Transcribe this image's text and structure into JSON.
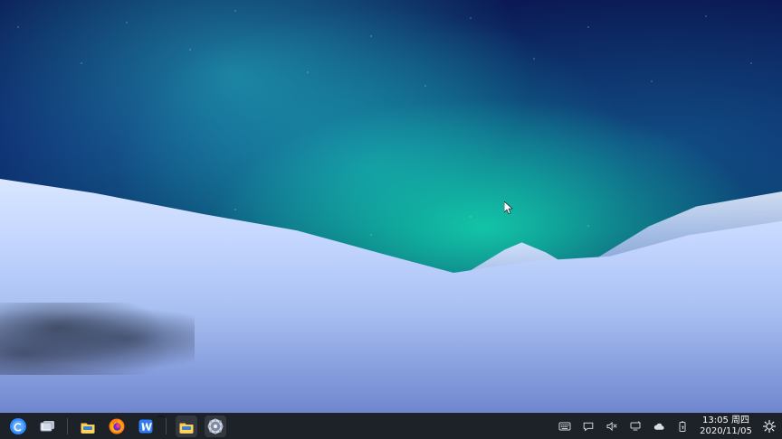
{
  "taskbar": {
    "apps": [
      {
        "name": "Start menu",
        "icon": "start-menu-icon"
      },
      {
        "name": "Show desktop",
        "icon": "desktop-switcher-icon"
      },
      {
        "name": "File manager",
        "icon": "folder-icon"
      },
      {
        "name": "Firefox",
        "icon": "firefox-icon"
      },
      {
        "name": "WPS Writer",
        "icon": "writer-icon"
      },
      {
        "name": "File manager (running)",
        "icon": "folder-icon"
      },
      {
        "name": "Settings",
        "icon": "settings-icon"
      }
    ],
    "tray": {
      "icons": [
        "keyboard-icon",
        "chat-icon",
        "volume-muted-icon",
        "network-icon",
        "cloud-icon",
        "battery-icon",
        "theme-icon"
      ]
    },
    "clock": {
      "time": "13:05 周四",
      "date": "2020/11/05"
    }
  },
  "colors": {
    "taskbar_bg": "#0A0E16",
    "accent": "#3AA0FF"
  }
}
